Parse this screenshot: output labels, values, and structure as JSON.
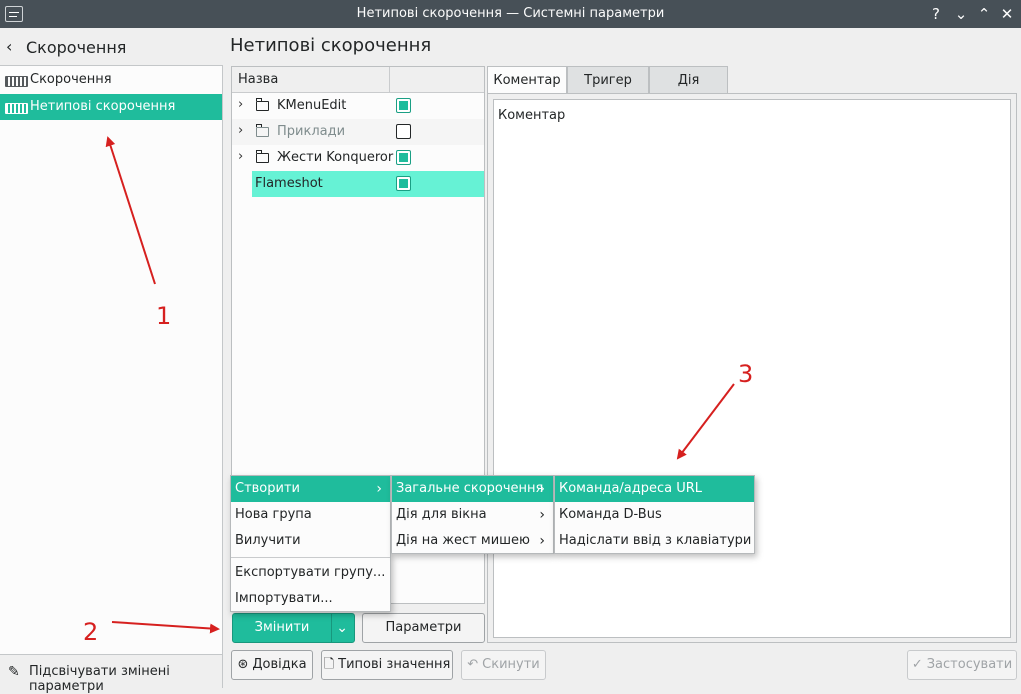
{
  "window": {
    "title": "Нетипові скорочення — Системні параметри",
    "buttons": [
      "?",
      "⌄",
      "⌃",
      "✕"
    ]
  },
  "sidebar": {
    "back_label": "Скорочення",
    "items": [
      {
        "label": "Скорочення",
        "icon": "keyboard-icon",
        "selected": false
      },
      {
        "label": "Нетипові скорочення",
        "icon": "keyboard-icon",
        "selected": true
      }
    ],
    "footer_label": "Підсвічувати змінені параметри"
  },
  "main": {
    "title": "Нетипові скорочення",
    "tree": {
      "column_header": "Назва",
      "rows": [
        {
          "name": "KMenuEdit",
          "checked": true,
          "dim": false
        },
        {
          "name": "Приклади",
          "checked": false,
          "dim": true
        },
        {
          "name": "Жести Konqueror",
          "checked": true,
          "dim": false
        },
        {
          "name": "Flameshot",
          "checked": true,
          "dim": false
        }
      ]
    },
    "tabs": [
      "Коментар",
      "Тригер",
      "Дія"
    ],
    "active_tab": "Коментар",
    "comment_label": "Коментар"
  },
  "buttons": {
    "change": "Змінити",
    "parameters": "Параметри",
    "help": "Довідка",
    "defaults": "Типові значення",
    "reset": "Скинути",
    "apply": "Застосувати"
  },
  "menu_main": {
    "items": [
      "Створити",
      "Нова група",
      "Вилучити",
      "Експортувати групу...",
      "Імпортувати..."
    ]
  },
  "menu_create": {
    "items": [
      "Загальне скорочення",
      "Дія для вікна",
      "Дія на жест мишею"
    ]
  },
  "menu_general": {
    "items": [
      "Команда/адреса URL",
      "Команда D-Bus",
      "Надіслати ввід з клавіатури"
    ]
  },
  "annotations": [
    "1",
    "2",
    "3"
  ],
  "colors": {
    "accent": "#1fbc9c",
    "selection_light": "#66f2d5",
    "titlebar": "#475057",
    "annotation": "#d6201f"
  }
}
